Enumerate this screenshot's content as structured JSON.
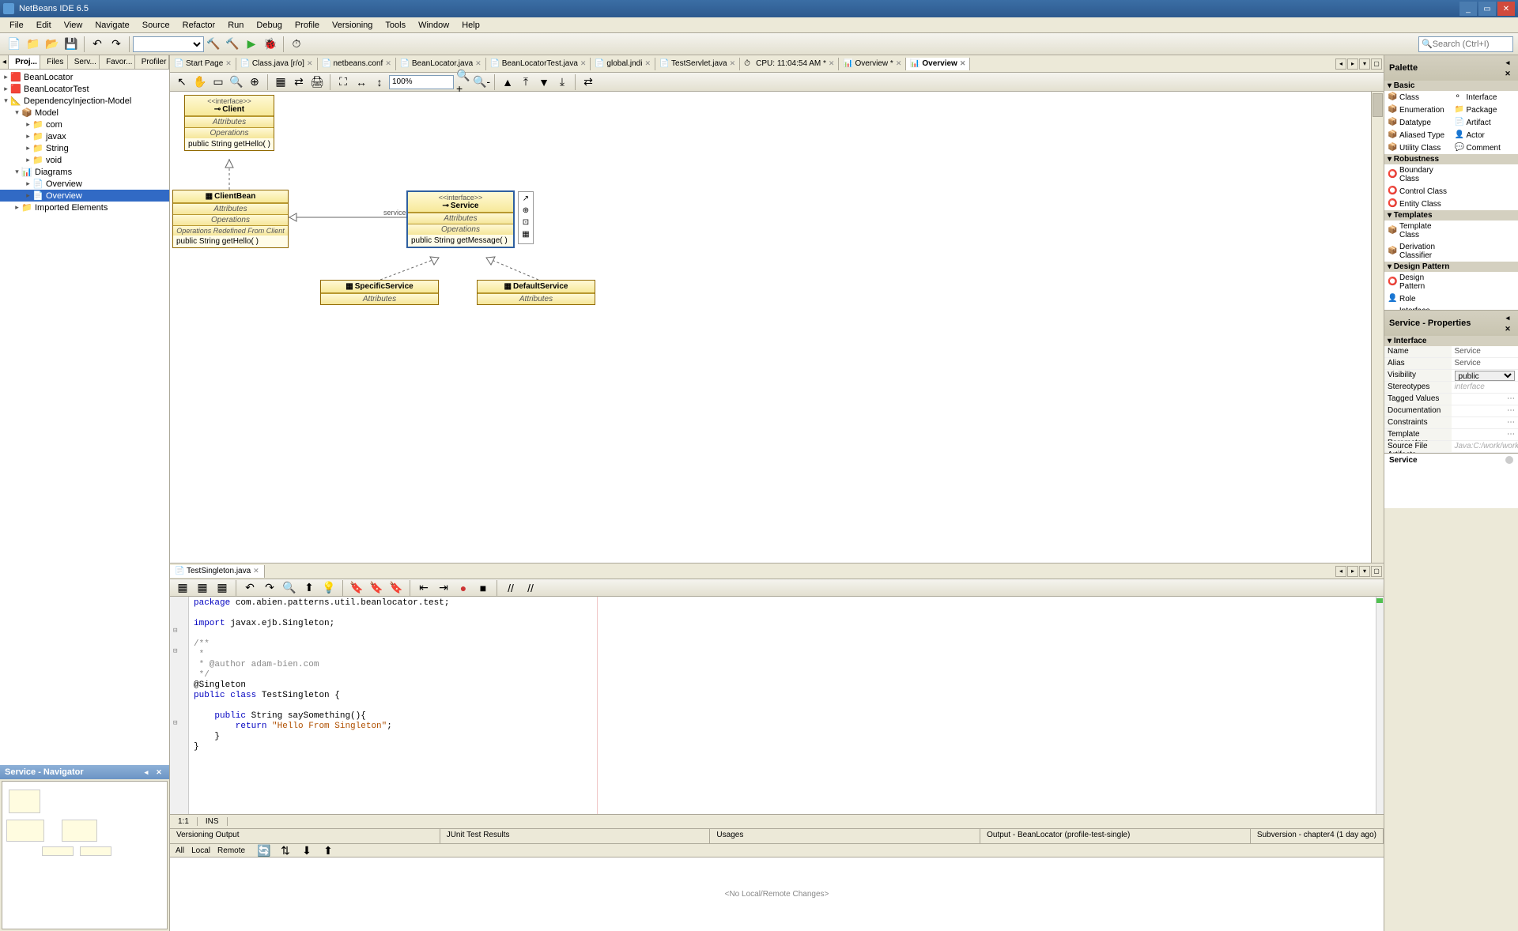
{
  "title": "NetBeans IDE 6.5",
  "menu": [
    "File",
    "Edit",
    "View",
    "Navigate",
    "Source",
    "Refactor",
    "Run",
    "Debug",
    "Profile",
    "Versioning",
    "Tools",
    "Window",
    "Help"
  ],
  "search_placeholder": "Search (Ctrl+I)",
  "project_tabs": [
    "Proj...",
    "Files",
    "Serv...",
    "Favor...",
    "Profiler"
  ],
  "tree": [
    {
      "l": 0,
      "a": "▸",
      "i": "🟥",
      "t": "BeanLocator"
    },
    {
      "l": 0,
      "a": "▸",
      "i": "🟥",
      "t": "BeanLocatorTest"
    },
    {
      "l": 0,
      "a": "▾",
      "i": "📐",
      "t": "DependencyInjection-Model"
    },
    {
      "l": 1,
      "a": "▾",
      "i": "📦",
      "t": "Model"
    },
    {
      "l": 2,
      "a": "▸",
      "i": "📁",
      "t": "com"
    },
    {
      "l": 2,
      "a": "▸",
      "i": "📁",
      "t": "javax"
    },
    {
      "l": 2,
      "a": "▸",
      "i": "📁",
      "t": "String"
    },
    {
      "l": 2,
      "a": "▸",
      "i": "📁",
      "t": "void"
    },
    {
      "l": 1,
      "a": "▾",
      "i": "📊",
      "t": "Diagrams"
    },
    {
      "l": 2,
      "a": "▸",
      "i": "📄",
      "t": "Overview"
    },
    {
      "l": 2,
      "a": "▸",
      "i": "📄",
      "t": "Overview",
      "sel": true
    },
    {
      "l": 1,
      "a": "▸",
      "i": "📁",
      "t": "Imported Elements"
    }
  ],
  "navigator_title": "Service - Navigator",
  "editor_tabs": [
    {
      "i": "📄",
      "t": "Start Page"
    },
    {
      "i": "📄",
      "t": "Class.java [r/o]"
    },
    {
      "i": "📄",
      "t": "netbeans.conf"
    },
    {
      "i": "📄",
      "t": "BeanLocator.java"
    },
    {
      "i": "📄",
      "t": "BeanLocatorTest.java"
    },
    {
      "i": "📄",
      "t": "global.jndi"
    },
    {
      "i": "📄",
      "t": "TestServlet.java"
    },
    {
      "i": "⏱",
      "t": "CPU: 11:04:54 AM *"
    },
    {
      "i": "📊",
      "t": "Overview *"
    },
    {
      "i": "📊",
      "t": "Overview",
      "active": true
    }
  ],
  "zoom": "100%",
  "uml": {
    "client": {
      "stereotype": "<<interface>>",
      "name": "Client",
      "attrs": "Attributes",
      "ops": "Operations",
      "op1": "public String  getHello(  )"
    },
    "clientbean": {
      "name": "ClientBean",
      "attrs": "Attributes",
      "ops": "Operations",
      "redef": "Operations Redefined From Client",
      "op1": "public String  getHello(  )"
    },
    "service": {
      "stereotype": "<<interface>>",
      "name": "Service",
      "attrs": "Attributes",
      "ops": "Operations",
      "op1": "public String  getMessage(  )",
      "assoc": "service"
    },
    "specific": {
      "name": "SpecificService",
      "attrs": "Attributes"
    },
    "default": {
      "name": "DefaultService",
      "attrs": "Attributes"
    }
  },
  "code_tab": "TestSingleton.java",
  "code_lines": [
    {
      "t": "package ",
      "k": true
    },
    {
      "t": "com.abien.patterns.util.beanlocator.test;\n\n"
    },
    {
      "t": "import ",
      "k": true
    },
    {
      "t": "javax.ejb.Singleton;\n\n"
    },
    {
      "t": "/**\n *\n * @author adam-bien.com\n */\n",
      "c": true
    },
    {
      "t": "@Singleton\n"
    },
    {
      "t": "public class ",
      "k": true
    },
    {
      "t": "TestSingleton {\n\n"
    },
    {
      "t": "    public ",
      "k": true
    },
    {
      "t": "String saySomething(){\n"
    },
    {
      "t": "        return ",
      "k": true
    },
    {
      "t": "\"Hello From Singleton\"",
      "s": true
    },
    {
      "t": ";\n"
    },
    {
      "t": "    }\n}\n"
    }
  ],
  "code_status": {
    "pos": "1:1",
    "mode": "INS"
  },
  "output_tabs": [
    "Versioning Output",
    "JUnit Test Results",
    "Usages",
    "Output - BeanLocator (profile-test-single)",
    "Subversion - chapter4 (1 day ago)"
  ],
  "output_modes": [
    "All",
    "Local",
    "Remote"
  ],
  "output_msg": "<No Local/Remote Changes>",
  "palette": {
    "title": "Palette",
    "cats": [
      {
        "name": "Basic",
        "items": [
          [
            "📦",
            "Class"
          ],
          [
            "⚬",
            "Interface"
          ],
          [
            "📦",
            "Enumeration"
          ],
          [
            "📁",
            "Package"
          ],
          [
            "📦",
            "Datatype"
          ],
          [
            "📄",
            "Artifact"
          ],
          [
            "📦",
            "Aliased Type"
          ],
          [
            "👤",
            "Actor"
          ],
          [
            "📦",
            "Utility Class"
          ],
          [
            "💬",
            "Comment"
          ]
        ]
      },
      {
        "name": "Robustness",
        "items": [
          [
            "⭕",
            "Boundary Class"
          ],
          [
            "",
            ""
          ],
          [
            "⭕",
            "Control Class"
          ],
          [
            "",
            ""
          ],
          [
            "⭕",
            "Entity Class"
          ],
          [
            "",
            ""
          ]
        ]
      },
      {
        "name": "Templates",
        "items": [
          [
            "📦",
            "Template Class"
          ],
          [
            "",
            ""
          ],
          [
            "📦",
            "Derivation Classifier"
          ],
          [
            "",
            ""
          ]
        ]
      },
      {
        "name": "Design Pattern",
        "items": [
          [
            "⭕",
            "Design Pattern"
          ],
          [
            "",
            ""
          ],
          [
            "👤",
            "Role"
          ],
          [
            "",
            ""
          ],
          [
            "⚬",
            "Interface Role"
          ],
          [
            "",
            ""
          ]
        ]
      }
    ]
  },
  "props": {
    "title": "Service - Properties",
    "cat": "Interface",
    "rows": [
      {
        "n": "Name",
        "v": "Service"
      },
      {
        "n": "Alias",
        "v": "Service"
      },
      {
        "n": "Visibility",
        "v": "public",
        "sel": true
      },
      {
        "n": "Stereotypes",
        "v": "interface",
        "hint": true
      },
      {
        "n": "Tagged Values",
        "v": "",
        "dots": true
      },
      {
        "n": "Documentation",
        "v": "",
        "dots": true
      },
      {
        "n": "Constraints",
        "v": "",
        "dots": true
      },
      {
        "n": "Template Parameters",
        "v": "",
        "dots": true
      },
      {
        "n": "Source File Artifacts",
        "v": "Java:C:/work/works",
        "hint": true
      }
    ],
    "preview": "Service"
  }
}
